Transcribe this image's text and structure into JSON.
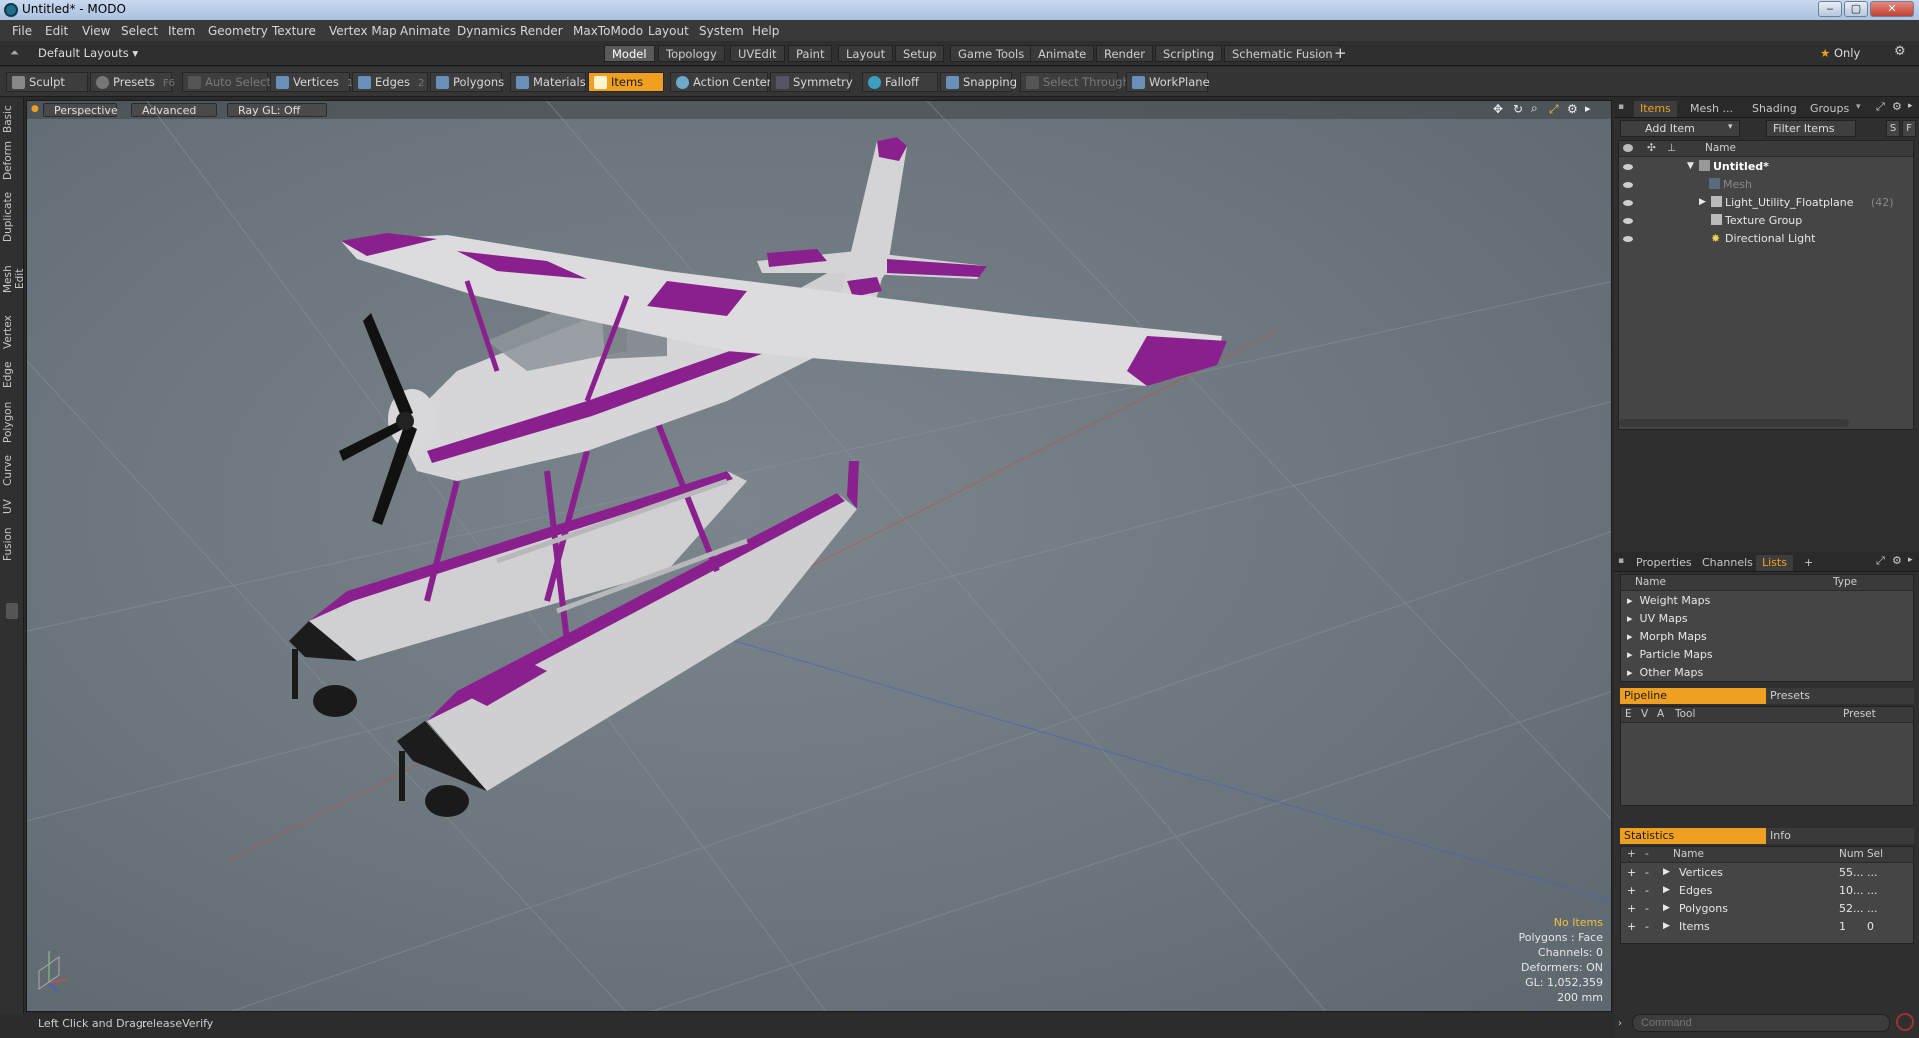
{
  "window": {
    "title": "Untitled* - MODO",
    "min": "‒",
    "max": "▢",
    "close": "✕"
  },
  "menus": [
    "File",
    "Edit",
    "View",
    "Select",
    "Item",
    "Geometry",
    "Texture",
    "Vertex Map",
    "Animate",
    "Dynamics",
    "Render",
    "MaxToModo",
    "Layout",
    "System",
    "Help"
  ],
  "layouts": {
    "selector": "Default Layouts",
    "tabs": [
      "Model",
      "Topology",
      "UVEdit",
      "Paint",
      "Layout",
      "Setup",
      "Game Tools",
      "Animate",
      "Render",
      "Scripting",
      "Schematic Fusion"
    ],
    "active": "Model",
    "add": "+",
    "only": "Only"
  },
  "toolbar": {
    "sculpt": "Sculpt",
    "presets": "Presets",
    "presets_key": "F6",
    "auto_select": "Auto Select",
    "vertices": "Vertices",
    "vertices_key": "1",
    "edges": "Edges",
    "edges_key": "2",
    "polygons": "Polygons",
    "materials": "Materials",
    "items": "Items",
    "action_center": "Action Center",
    "symmetry": "Symmetry",
    "falloff": "Falloff",
    "snapping": "Snapping",
    "select_through": "Select Through",
    "workplane": "WorkPlane"
  },
  "left_tabs": [
    "Basic",
    "Deform",
    "Duplicate",
    "Mesh Edit",
    "Vertex",
    "Edge",
    "Polygon",
    "Curve",
    "UV",
    "Fusion"
  ],
  "viewport": {
    "perspective": "Perspective",
    "advanced": "Advanced",
    "raygl": "Ray GL: Off",
    "stats": {
      "no_items": "No Items",
      "polygons": "Polygons : Face",
      "channels": "Channels: 0",
      "deformers": "Deformers: ON",
      "gl": "GL: 1,052,359",
      "scale": "200 mm"
    }
  },
  "status": {
    "hint": "Left Click and Drag:",
    "action": "releaseVerify"
  },
  "items_panel": {
    "tabs": [
      "Items",
      "Mesh ...",
      "Shading",
      "Groups"
    ],
    "add_item": "Add Item",
    "filter": "Filter Items",
    "s_btn": "S",
    "f_btn": "F",
    "name_header": "Name",
    "tree": [
      {
        "label": "Untitled*",
        "count": ""
      },
      {
        "label": "Mesh",
        "count": ""
      },
      {
        "label": "Light_Utility_Floatplane",
        "count": "(42)"
      },
      {
        "label": "Texture Group",
        "count": ""
      },
      {
        "label": "Directional Light",
        "count": ""
      }
    ]
  },
  "lists_panel": {
    "tabs": [
      "Properties",
      "Channels",
      "Lists",
      "+"
    ],
    "headers": [
      "Name",
      "Type"
    ],
    "rows": [
      "Weight Maps",
      "UV Maps",
      "Morph Maps",
      "Particle Maps",
      "Other Maps"
    ]
  },
  "pipeline_panel": {
    "tabs": [
      "Pipeline",
      "Presets"
    ],
    "headers": [
      "E",
      "V",
      "A",
      "Tool",
      "Preset"
    ]
  },
  "stats_panel": {
    "tabs": [
      "Statistics",
      "Info"
    ],
    "headers": [
      "+",
      "-",
      "Name",
      "Num",
      "Sel"
    ],
    "rows": [
      {
        "name": "Vertices",
        "num": "55...",
        "sel": "..."
      },
      {
        "name": "Edges",
        "num": "10...",
        "sel": "..."
      },
      {
        "name": "Polygons",
        "num": "52...",
        "sel": "..."
      },
      {
        "name": "Items",
        "num": "1",
        "sel": "0"
      }
    ]
  },
  "command": {
    "placeholder": "Command"
  },
  "colors": {
    "accent": "#f0a020",
    "livery": "#8a1f8e"
  }
}
